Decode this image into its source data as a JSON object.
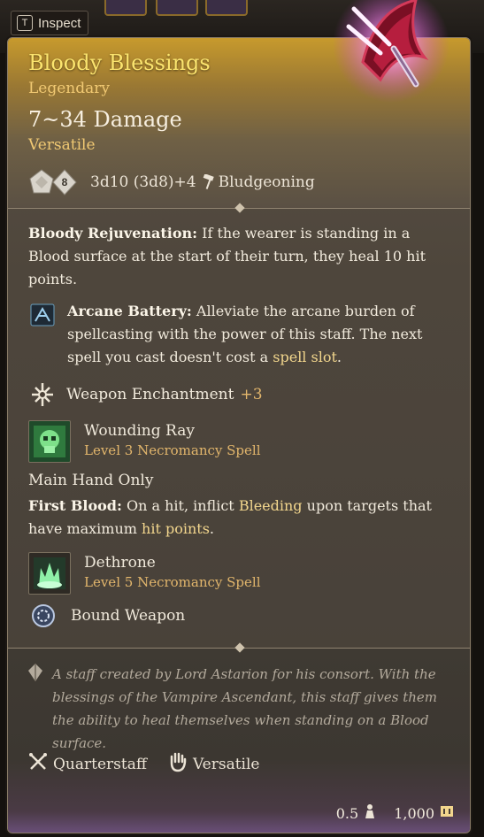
{
  "inspect": {
    "key": "T",
    "label": "Inspect"
  },
  "item": {
    "name": "Bloody Blessings",
    "rarity": "Legendary",
    "damage": "7~34 Damage",
    "property_sub": "Versatile",
    "dice": [
      {
        "icon": "d10-die-icon",
        "label": ""
      },
      {
        "icon": "d8-die-icon",
        "label": "8"
      }
    ],
    "dice_formula": "3d10 (3d8)+4",
    "damage_type": "Bludgeoning",
    "damage_type_icon": "hammer-icon",
    "art_icon": "glowing-staff-head-icon"
  },
  "passives": {
    "rejuvenation_title": "Bloody Rejuvenation:",
    "rejuvenation_text": "If the wearer is standing in a Blood surface at the start of their turn, they heal 10 hit points.",
    "battery_icon": "arcane-battery-icon",
    "battery_title": "Arcane Battery:",
    "battery_text": "Alleviate the arcane burden of spellcasting with the power of this staff. The next spell you cast doesn't cost a",
    "battery_link": "spell slot",
    "battery_end": ".",
    "enchant_icon": "weapon-enchantment-icon",
    "enchant_label": "Weapon Enchantment",
    "enchant_value": "+3"
  },
  "spells": [
    {
      "icon": "wounding-ray-icon",
      "name": "Wounding Ray",
      "school": "Level 3 Necromancy Spell"
    },
    {
      "icon": "dethrone-icon",
      "name": "Dethrone",
      "school": "Level 5 Necromancy Spell"
    }
  ],
  "main_hand": {
    "label": "Main Hand Only",
    "title": "First Blood:",
    "text_a": "On a hit, inflict",
    "link_a": "Bleeding",
    "text_b": "upon targets that have maximum",
    "link_b": "hit points",
    "text_c": "."
  },
  "bound": {
    "icon": "bound-weapon-icon",
    "label": "Bound Weapon"
  },
  "flavor": "A staff created by Lord Astarion for his consort. With the blessings of the Vampire Ascendant, this staff gives them the ability to heal themselves when standing on a Blood surface.",
  "properties": [
    {
      "icon": "quarterstaff-icon",
      "label": "Quarterstaff"
    },
    {
      "icon": "versatile-hand-icon",
      "label": "Versatile"
    }
  ],
  "footer": {
    "weight": "0.5",
    "weight_icon": "weight-icon",
    "price": "1,000",
    "price_icon": "gold-coin-icon"
  },
  "colors": {
    "title": "#fbe46e",
    "rarity": "#f1c973",
    "highlight": "#f2d68d",
    "school": "#e2b66c"
  }
}
